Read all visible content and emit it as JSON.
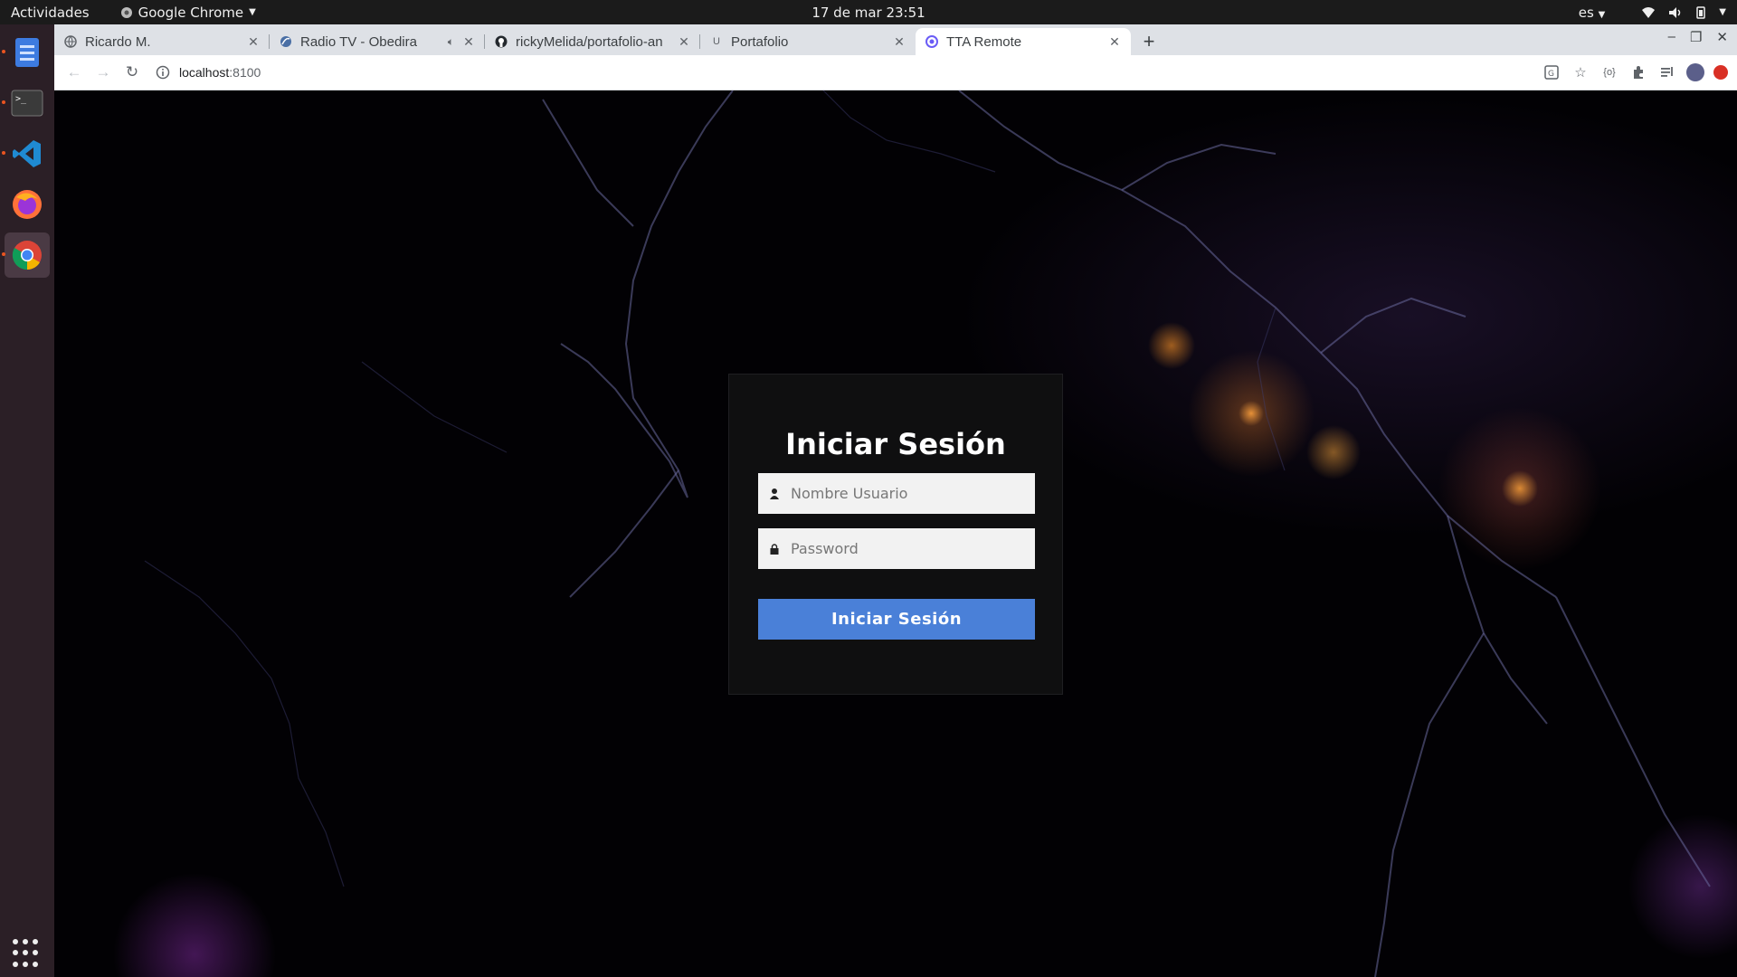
{
  "desktop": {
    "activities": "Actividades",
    "app_menu": "Google Chrome",
    "clock": "17 de mar  23:51",
    "lang": "es",
    "dock": [
      {
        "name": "files",
        "active": false
      },
      {
        "name": "terminal",
        "active": false
      },
      {
        "name": "vscode",
        "active": false
      },
      {
        "name": "firefox",
        "active": false
      },
      {
        "name": "chrome",
        "active": true
      }
    ]
  },
  "browser": {
    "tabs": [
      {
        "title": "Ricardo M.",
        "active": false
      },
      {
        "title": "Radio TV - Obedira",
        "active": false,
        "audio": true
      },
      {
        "title": "rickyMelida/portafolio-an",
        "active": false
      },
      {
        "title": "Portafolio",
        "active": false
      },
      {
        "title": "TTA Remote",
        "active": true
      }
    ],
    "url_host": "localhost",
    "url_port": ":8100"
  },
  "login": {
    "title": "Iniciar Sesión",
    "username_placeholder": "Nombre Usuario",
    "password_placeholder": "Password",
    "submit_label": "Iniciar Sesión",
    "button_color": "#4a80d8"
  }
}
